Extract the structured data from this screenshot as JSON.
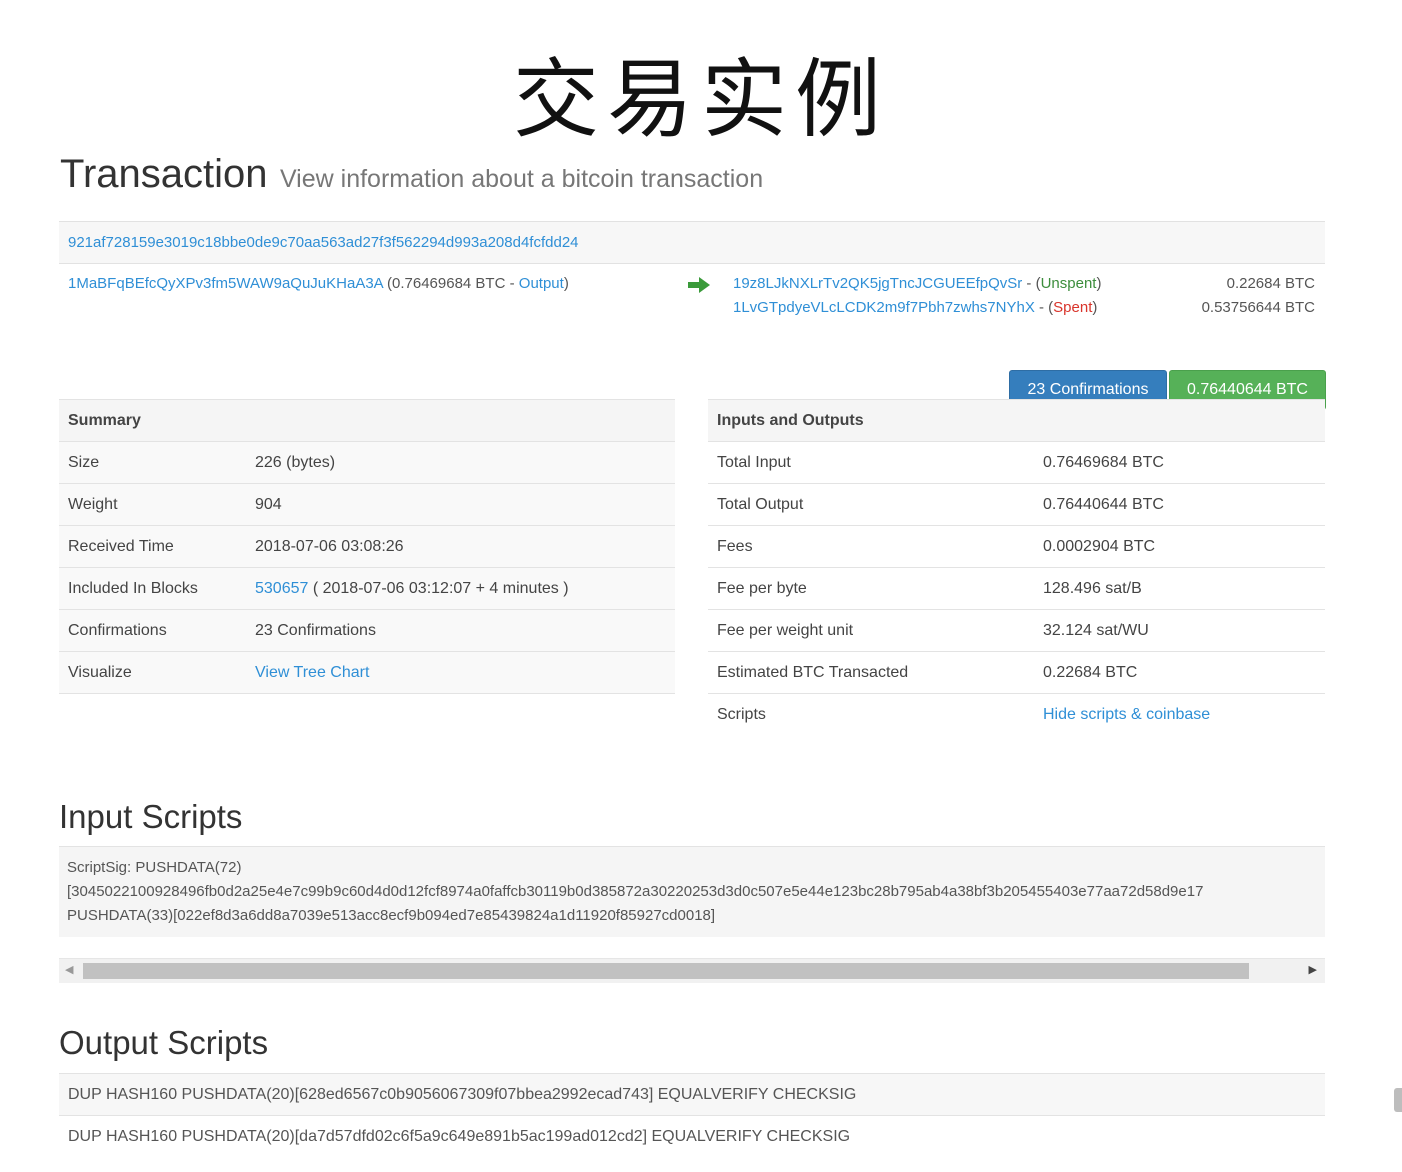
{
  "banner": {
    "title": "交易实例"
  },
  "header": {
    "title": "Transaction",
    "subtitle": "View information about a bitcoin transaction"
  },
  "transaction": {
    "hash": "921af728159e3019c18bbe0de9c70aa563ad27f3f562294d993a208d4fcfdd24",
    "input": {
      "address": "1MaBFqBEfcQyXPv3fm5WAW9aQuJuKHaA3A",
      "amount": "0.76469684 BTC",
      "output_label": "Output"
    },
    "outputs": [
      {
        "address": "19z8LJkNXLrTv2QK5jgTncJCGUEEfpQvSr",
        "status": "Unspent",
        "amount": "0.22684 BTC"
      },
      {
        "address": "1LvGTpdyeVLcLCDK2m9f7Pbh7zwhs7NYhX",
        "status": "Spent",
        "amount": "0.53756644 BTC"
      }
    ],
    "confirmations_button": "23 Confirmations",
    "total_button": "0.76440644 BTC"
  },
  "summary": {
    "title": "Summary",
    "size_label": "Size",
    "size_value": "226 (bytes)",
    "weight_label": "Weight",
    "weight_value": "904",
    "received_label": "Received Time",
    "received_value": "2018-07-06 03:08:26",
    "blocks_label": "Included In Blocks",
    "block_number": "530657",
    "block_detail": " ( 2018-07-06 03:12:07 + 4 minutes )",
    "confirmations_label": "Confirmations",
    "confirmations_value": "23 Confirmations",
    "visualize_label": "Visualize",
    "visualize_link": "View Tree Chart"
  },
  "io": {
    "title": "Inputs and Outputs",
    "total_input_label": "Total Input",
    "total_input_value": "0.76469684 BTC",
    "total_output_label": "Total Output",
    "total_output_value": "0.76440644 BTC",
    "fees_label": "Fees",
    "fees_value": "0.0002904 BTC",
    "fee_byte_label": "Fee per byte",
    "fee_byte_value": "128.496 sat/B",
    "fee_weight_label": "Fee per weight unit",
    "fee_weight_value": "32.124 sat/WU",
    "estimated_label": "Estimated BTC Transacted",
    "estimated_value": "0.22684 BTC",
    "scripts_label": "Scripts",
    "scripts_link": "Hide scripts & coinbase"
  },
  "input_scripts": {
    "title": "Input Scripts",
    "line1": "ScriptSig: PUSHDATA(72)",
    "line2": "[3045022100928496fb0d2a25e4e7c99b9c60d4d0d12fcf8974a0faffcb30119b0d385872a30220253d3d0c507e5e44e123bc28b795ab4a38bf3b205455403e77aa72d58d9e17",
    "line3": "PUSHDATA(33)[022ef8d3a6dd8a7039e513acc8ecf9b094ed7e85439824a1d11920f85927cd0018]"
  },
  "output_scripts": {
    "title": "Output Scripts",
    "rows": [
      "DUP HASH160 PUSHDATA(20)[628ed6567c0b9056067309f07bbea2992ecad743] EQUALVERIFY CHECKSIG",
      "DUP HASH160 PUSHDATA(20)[da7d57dfd02c6f5a9c649e891b5ac199ad012cd2] EQUALVERIFY CHECKSIG"
    ]
  },
  "colors": {
    "link": "#2f8fd6",
    "unspent": "#3c8d3c",
    "spent": "#d9342b",
    "confirm_button": "#357ebd",
    "total_button": "#56b158"
  },
  "icons": {
    "arrow": "right-arrow-icon",
    "scroll_left": "scroll-left-icon",
    "scroll_right": "scroll-right-icon"
  }
}
